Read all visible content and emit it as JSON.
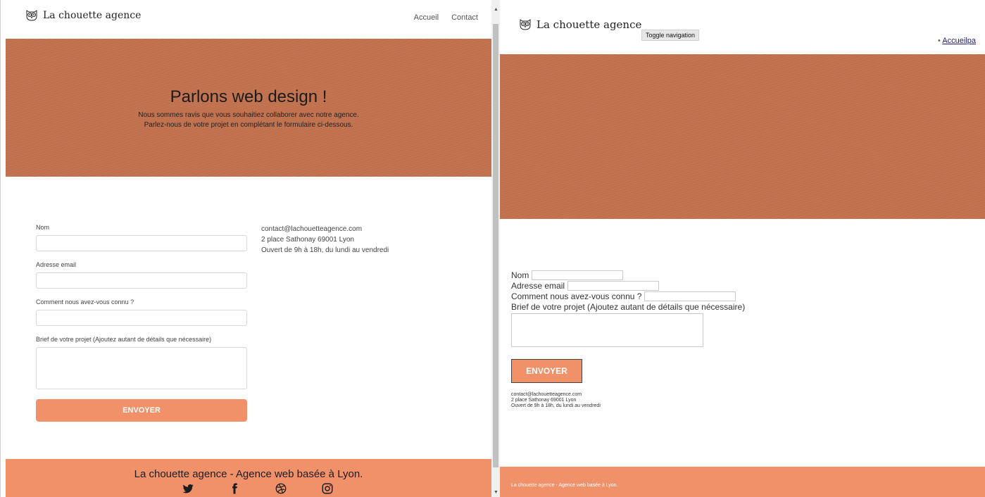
{
  "brand": {
    "name": "La chouette agence"
  },
  "left": {
    "nav": {
      "home": "Accueil",
      "contact": "Contact"
    },
    "hero": {
      "title": "Parlons web design !",
      "line1": "Nous sommes ravis que vous souhaitiez collaborer avec notre agence.",
      "line2": "Parlez-nous de votre projet en complétant le formulaire ci-dessous."
    },
    "form": {
      "name_label": "Nom",
      "email_label": "Adresse email",
      "source_label": "Comment nous avez-vous connu ?",
      "brief_label": "Brief de votre projet (Ajoutez autant de détails que nécessaire)",
      "submit": "ENVOYER"
    },
    "contact": {
      "email": "contact@lachouetteagence.com",
      "address": "2 place Sathonay 69001 Lyon",
      "hours": "Ouvert de 9h à 18h, du lundi au vendredi"
    },
    "footer": {
      "text": "La chouette agence - Agence web basée à Lyon.",
      "social_icons": [
        "twitter-icon",
        "facebook-icon",
        "dribbble-icon",
        "instagram-icon"
      ]
    }
  },
  "right": {
    "toggle": "Toggle navigation",
    "links_bullet": "•",
    "links_text": "Accueilpa",
    "form": {
      "name_label": "Nom",
      "email_label": "Adresse email",
      "source_label": "Comment nous avez-vous connu ?",
      "brief_label": "Brief de votre projet (Ajoutez autant de détails que nécessaire)",
      "submit": "ENVOYER"
    },
    "contact": {
      "email": "contact@lachouetteagence.com",
      "address": "2 place Sathonay 69001 Lyon",
      "hours": "Ouvert de 9h à 18h, du lundi au vendredi"
    },
    "footer": {
      "text": "La chouette agence - Agence web basée à Lyon."
    }
  },
  "colors": {
    "hero": "#c3734f",
    "accent": "#f1916a"
  }
}
